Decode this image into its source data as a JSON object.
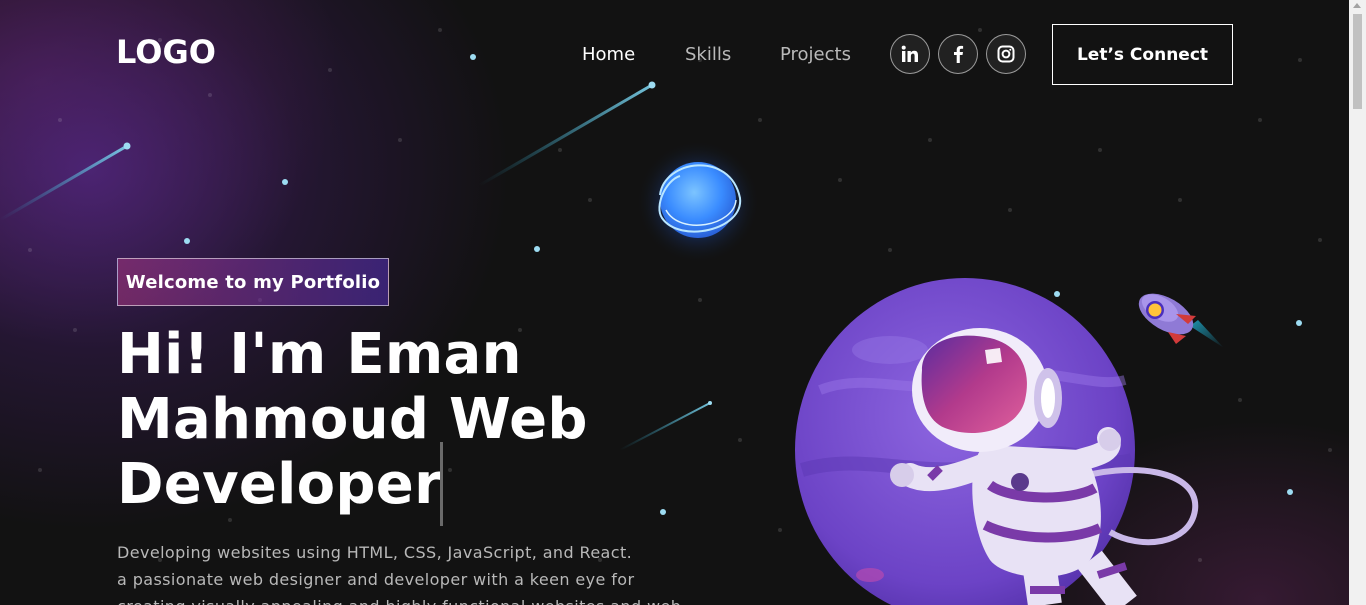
{
  "nav": {
    "logo": "LOGO",
    "links": [
      {
        "label": "Home",
        "active": true
      },
      {
        "label": "Skills",
        "active": false
      },
      {
        "label": "Projects",
        "active": false
      }
    ],
    "social": [
      {
        "icon": "linkedin-icon"
      },
      {
        "icon": "facebook-icon"
      },
      {
        "icon": "instagram-icon"
      }
    ],
    "connect_label": "Let’s Connect"
  },
  "hero": {
    "tagline": "Welcome to my Portfolio",
    "headline_lines": [
      "Hi! I'm Eman",
      "Mahmoud Web",
      "Developer"
    ],
    "description_lines": [
      "Developing websites using HTML, CSS, JavaScript, and React.",
      "a passionate web designer and developer with a keen eye for",
      "creating visually appealing and highly functional websites and web"
    ],
    "illustration": "astronaut-planet-illustration"
  },
  "colors": {
    "background": "#121212",
    "accent_start": "#AA367C",
    "accent_end": "#4A2FBD",
    "text": "#ffffff",
    "muted_text": "#b8b8b8"
  }
}
